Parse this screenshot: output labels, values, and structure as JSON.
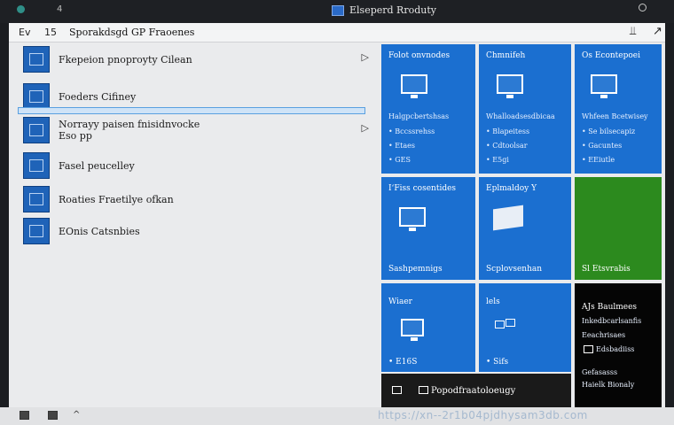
{
  "topbar": {
    "title": "Elseperd Rroduty",
    "number": "4"
  },
  "window": {
    "header_back": "Ev",
    "header_num": "15",
    "header_title": "Sporakdsgd GP Fraoenes",
    "pin_icon": "pin-icon",
    "close_icon": "close-icon"
  },
  "list": {
    "items": [
      {
        "label_1": "Fkepeion pnoproyty Cilean",
        "label_2": "",
        "icon": "display-icon",
        "chevron": "▷"
      },
      {
        "label_1": "Foeders Cifiney",
        "label_2": "",
        "icon": "window-icon",
        "chevron": ""
      },
      {
        "label_1": "Norrayy paisen fnisidnvocke",
        "label_2": "Eso pp",
        "icon": "network-icon",
        "chevron": "▷"
      },
      {
        "label_1": "Fasel peucelley",
        "label_2": "",
        "icon": "folder-icon",
        "chevron": ""
      },
      {
        "label_1": "Roaties Fraetilye ofkan",
        "label_2": "",
        "icon": "settings-icon",
        "chevron": ""
      },
      {
        "label_1": "EOnis Catsnbies",
        "label_2": "",
        "icon": "display-icon",
        "chevron": ""
      }
    ]
  },
  "tiles": [
    {
      "head": "Folot onvnodes",
      "lines": [
        "Halgpcbertshsas",
        "• Bccssrehss",
        "• Etaes",
        "• GES"
      ]
    },
    {
      "head": "Chmnifeh",
      "lines": [
        "Whalloadsesdbicaa",
        "• Blapeitess",
        "• Cdtoolsar",
        "• E5gi"
      ]
    },
    {
      "head": "Os Econtepoei",
      "lines": [
        "Whfeen Bcetwisey",
        "• Se bilsecapiz",
        "• Gacuntes",
        "• EEiutle"
      ]
    },
    {
      "head": "IʻFiss cosentides",
      "foot": "Sashpemnigs"
    },
    {
      "head": "Eplmaldoy Y",
      "foot": "Scplovsenhan"
    },
    {
      "head": "",
      "foot": "Sl Etsvrabis"
    },
    {
      "head": "Wiaer",
      "foot": "• E16S"
    },
    {
      "head": "lels",
      "foot": "• Sifs"
    },
    {
      "head": "AJs Baulmees",
      "lines": [
        "Inkedbcarlsanfis",
        "Eeachrisaes",
        "Edsbadiiss",
        "Gefasasss",
        "Haielk Bionaly"
      ]
    },
    {
      "footer": "Popodfraatoloeugy"
    }
  ],
  "bottombar": {
    "watermark": "https://xn--2r1b04pjdhysam3db.com"
  },
  "colors": {
    "tile_blue": "#1b6fd0",
    "tile_green": "#2c8a1e",
    "tile_black": "#050505"
  }
}
